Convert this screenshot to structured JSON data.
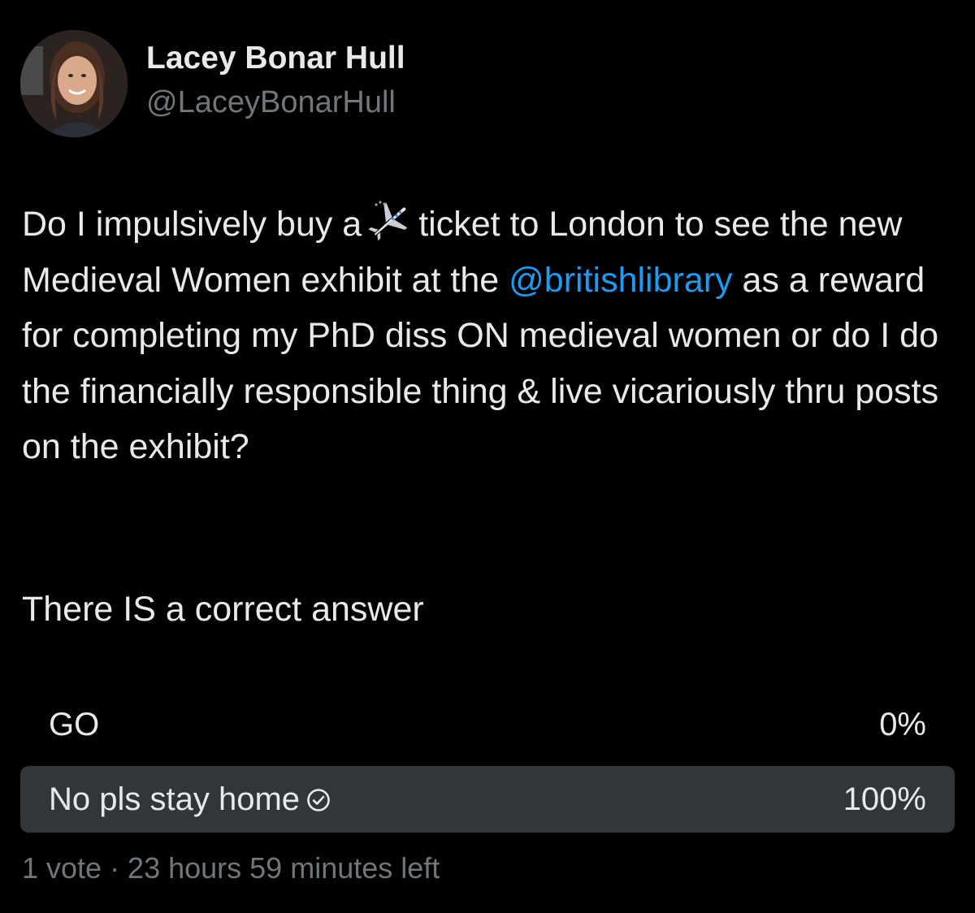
{
  "author": {
    "display_name": "Lacey Bonar Hull",
    "handle": "@LaceyBonarHull",
    "avatar_icon": "profile-photo"
  },
  "tweet": {
    "part1": "Do I impulsively buy a",
    "emoji": "airplane-icon",
    "part2": "ticket to London to see the new Medieval Women exhibit at the",
    "mention": "@britishlibrary",
    "part3": "as a reward for completing my PhD diss ON medieval women or do I do the financially responsible thing & live vicariously thru posts on the exhibit?",
    "tail": "There IS a correct answer",
    "mention_color": "#1d9bf0"
  },
  "poll": {
    "options": [
      {
        "label": "GO",
        "percent_label": "0%",
        "fraction": 0.0,
        "selected": false
      },
      {
        "label": "No pls stay home",
        "percent_label": "100%",
        "fraction": 1.0,
        "selected": true
      }
    ],
    "selected_icon": "check-circle-icon",
    "meta": "1 vote · 23 hours 59 minutes left",
    "fill_color": "#333639"
  }
}
